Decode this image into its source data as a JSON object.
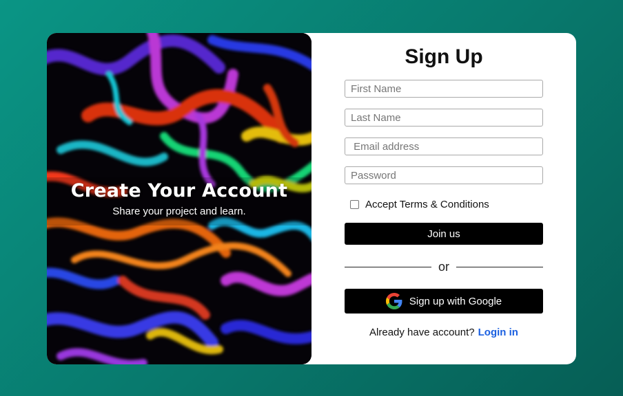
{
  "hero": {
    "title": "Create Your Account",
    "subtitle": "Share your project and learn."
  },
  "form": {
    "heading": "Sign Up",
    "first_name_placeholder": "First Name",
    "last_name_placeholder": "Last Name",
    "email_placeholder": " Email address",
    "password_placeholder": "Password",
    "terms_label": "Accept Terms & Conditions",
    "terms_checked": false,
    "join_label": "Join us",
    "divider_text": "or",
    "google_label": "Sign up with Google",
    "login_prompt": "Already have account?",
    "login_link": "Login in"
  },
  "colors": {
    "background": "#0a9585",
    "card": "#ffffff",
    "button": "#000000",
    "link": "#1a5fe0"
  },
  "icons": {
    "google": "google-icon",
    "checkbox": "checkbox-icon"
  }
}
